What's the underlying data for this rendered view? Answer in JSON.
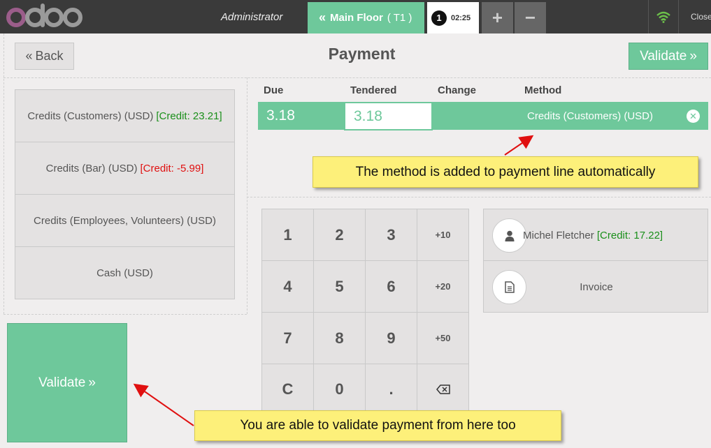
{
  "topbar": {
    "logo_text": "odoo",
    "user": "Administrator",
    "floor_label": "Main Floor",
    "floor_table": "( T1 )",
    "order_number": "1",
    "order_time": "02:25",
    "add_icon": "plus-icon",
    "remove_icon": "minus-icon",
    "wifi_icon": "wifi-icon",
    "close_label": "Close"
  },
  "header": {
    "back_label": "Back",
    "title": "Payment",
    "validate_label": "Validate"
  },
  "payment_methods": [
    {
      "label": "Credits (Customers) (USD)",
      "credit": "[Credit: 23.21]",
      "credit_status": "positive"
    },
    {
      "label": "Credits (Bar) (USD)",
      "credit": "[Credit: -5.99]",
      "credit_status": "negative"
    },
    {
      "label": "Credits (Employees, Volunteers) (USD)",
      "credit": ""
    },
    {
      "label": "Cash (USD)",
      "credit": ""
    }
  ],
  "payment_lines": {
    "headers": {
      "due": "Due",
      "tendered": "Tendered",
      "change": "Change",
      "method": "Method"
    },
    "rows": [
      {
        "due": "3.18",
        "tendered": "3.18",
        "change": "",
        "method": "Credits (Customers) (USD)"
      }
    ]
  },
  "numpad": {
    "keys": [
      "1",
      "2",
      "3",
      "+10",
      "4",
      "5",
      "6",
      "+20",
      "7",
      "8",
      "9",
      "+50",
      "C",
      "0",
      ".",
      "⌫"
    ]
  },
  "customer": {
    "name": "Michel Fletcher",
    "credit": "[Credit: 17.22]",
    "icon": "user-icon"
  },
  "invoice": {
    "label": "Invoice",
    "icon": "document-icon"
  },
  "validate_big_label": "Validate",
  "annotations": {
    "callout1": "The method is added to payment line automatically",
    "callout2": "You are able to validate payment from here too"
  },
  "colors": {
    "accent": "#6ec89b",
    "topbar": "#3a3a3a",
    "callout": "#fdf07a",
    "credit_positive": "#1a8f1a",
    "credit_negative": "#e01010",
    "arrow": "#e01010"
  }
}
